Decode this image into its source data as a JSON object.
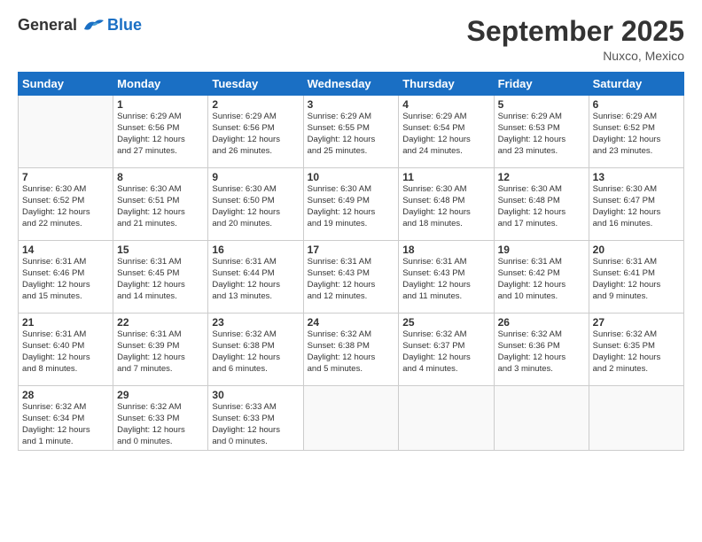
{
  "logo": {
    "general": "General",
    "blue": "Blue"
  },
  "title": "September 2025",
  "location": "Nuxco, Mexico",
  "days_header": [
    "Sunday",
    "Monday",
    "Tuesday",
    "Wednesday",
    "Thursday",
    "Friday",
    "Saturday"
  ],
  "weeks": [
    [
      {
        "num": "",
        "info": ""
      },
      {
        "num": "1",
        "info": "Sunrise: 6:29 AM\nSunset: 6:56 PM\nDaylight: 12 hours\nand 27 minutes."
      },
      {
        "num": "2",
        "info": "Sunrise: 6:29 AM\nSunset: 6:56 PM\nDaylight: 12 hours\nand 26 minutes."
      },
      {
        "num": "3",
        "info": "Sunrise: 6:29 AM\nSunset: 6:55 PM\nDaylight: 12 hours\nand 25 minutes."
      },
      {
        "num": "4",
        "info": "Sunrise: 6:29 AM\nSunset: 6:54 PM\nDaylight: 12 hours\nand 24 minutes."
      },
      {
        "num": "5",
        "info": "Sunrise: 6:29 AM\nSunset: 6:53 PM\nDaylight: 12 hours\nand 23 minutes."
      },
      {
        "num": "6",
        "info": "Sunrise: 6:29 AM\nSunset: 6:52 PM\nDaylight: 12 hours\nand 23 minutes."
      }
    ],
    [
      {
        "num": "7",
        "info": "Sunrise: 6:30 AM\nSunset: 6:52 PM\nDaylight: 12 hours\nand 22 minutes."
      },
      {
        "num": "8",
        "info": "Sunrise: 6:30 AM\nSunset: 6:51 PM\nDaylight: 12 hours\nand 21 minutes."
      },
      {
        "num": "9",
        "info": "Sunrise: 6:30 AM\nSunset: 6:50 PM\nDaylight: 12 hours\nand 20 minutes."
      },
      {
        "num": "10",
        "info": "Sunrise: 6:30 AM\nSunset: 6:49 PM\nDaylight: 12 hours\nand 19 minutes."
      },
      {
        "num": "11",
        "info": "Sunrise: 6:30 AM\nSunset: 6:48 PM\nDaylight: 12 hours\nand 18 minutes."
      },
      {
        "num": "12",
        "info": "Sunrise: 6:30 AM\nSunset: 6:48 PM\nDaylight: 12 hours\nand 17 minutes."
      },
      {
        "num": "13",
        "info": "Sunrise: 6:30 AM\nSunset: 6:47 PM\nDaylight: 12 hours\nand 16 minutes."
      }
    ],
    [
      {
        "num": "14",
        "info": "Sunrise: 6:31 AM\nSunset: 6:46 PM\nDaylight: 12 hours\nand 15 minutes."
      },
      {
        "num": "15",
        "info": "Sunrise: 6:31 AM\nSunset: 6:45 PM\nDaylight: 12 hours\nand 14 minutes."
      },
      {
        "num": "16",
        "info": "Sunrise: 6:31 AM\nSunset: 6:44 PM\nDaylight: 12 hours\nand 13 minutes."
      },
      {
        "num": "17",
        "info": "Sunrise: 6:31 AM\nSunset: 6:43 PM\nDaylight: 12 hours\nand 12 minutes."
      },
      {
        "num": "18",
        "info": "Sunrise: 6:31 AM\nSunset: 6:43 PM\nDaylight: 12 hours\nand 11 minutes."
      },
      {
        "num": "19",
        "info": "Sunrise: 6:31 AM\nSunset: 6:42 PM\nDaylight: 12 hours\nand 10 minutes."
      },
      {
        "num": "20",
        "info": "Sunrise: 6:31 AM\nSunset: 6:41 PM\nDaylight: 12 hours\nand 9 minutes."
      }
    ],
    [
      {
        "num": "21",
        "info": "Sunrise: 6:31 AM\nSunset: 6:40 PM\nDaylight: 12 hours\nand 8 minutes."
      },
      {
        "num": "22",
        "info": "Sunrise: 6:31 AM\nSunset: 6:39 PM\nDaylight: 12 hours\nand 7 minutes."
      },
      {
        "num": "23",
        "info": "Sunrise: 6:32 AM\nSunset: 6:38 PM\nDaylight: 12 hours\nand 6 minutes."
      },
      {
        "num": "24",
        "info": "Sunrise: 6:32 AM\nSunset: 6:38 PM\nDaylight: 12 hours\nand 5 minutes."
      },
      {
        "num": "25",
        "info": "Sunrise: 6:32 AM\nSunset: 6:37 PM\nDaylight: 12 hours\nand 4 minutes."
      },
      {
        "num": "26",
        "info": "Sunrise: 6:32 AM\nSunset: 6:36 PM\nDaylight: 12 hours\nand 3 minutes."
      },
      {
        "num": "27",
        "info": "Sunrise: 6:32 AM\nSunset: 6:35 PM\nDaylight: 12 hours\nand 2 minutes."
      }
    ],
    [
      {
        "num": "28",
        "info": "Sunrise: 6:32 AM\nSunset: 6:34 PM\nDaylight: 12 hours\nand 1 minute."
      },
      {
        "num": "29",
        "info": "Sunrise: 6:32 AM\nSunset: 6:33 PM\nDaylight: 12 hours\nand 0 minutes."
      },
      {
        "num": "30",
        "info": "Sunrise: 6:33 AM\nSunset: 6:33 PM\nDaylight: 12 hours\nand 0 minutes."
      },
      {
        "num": "",
        "info": ""
      },
      {
        "num": "",
        "info": ""
      },
      {
        "num": "",
        "info": ""
      },
      {
        "num": "",
        "info": ""
      }
    ]
  ]
}
